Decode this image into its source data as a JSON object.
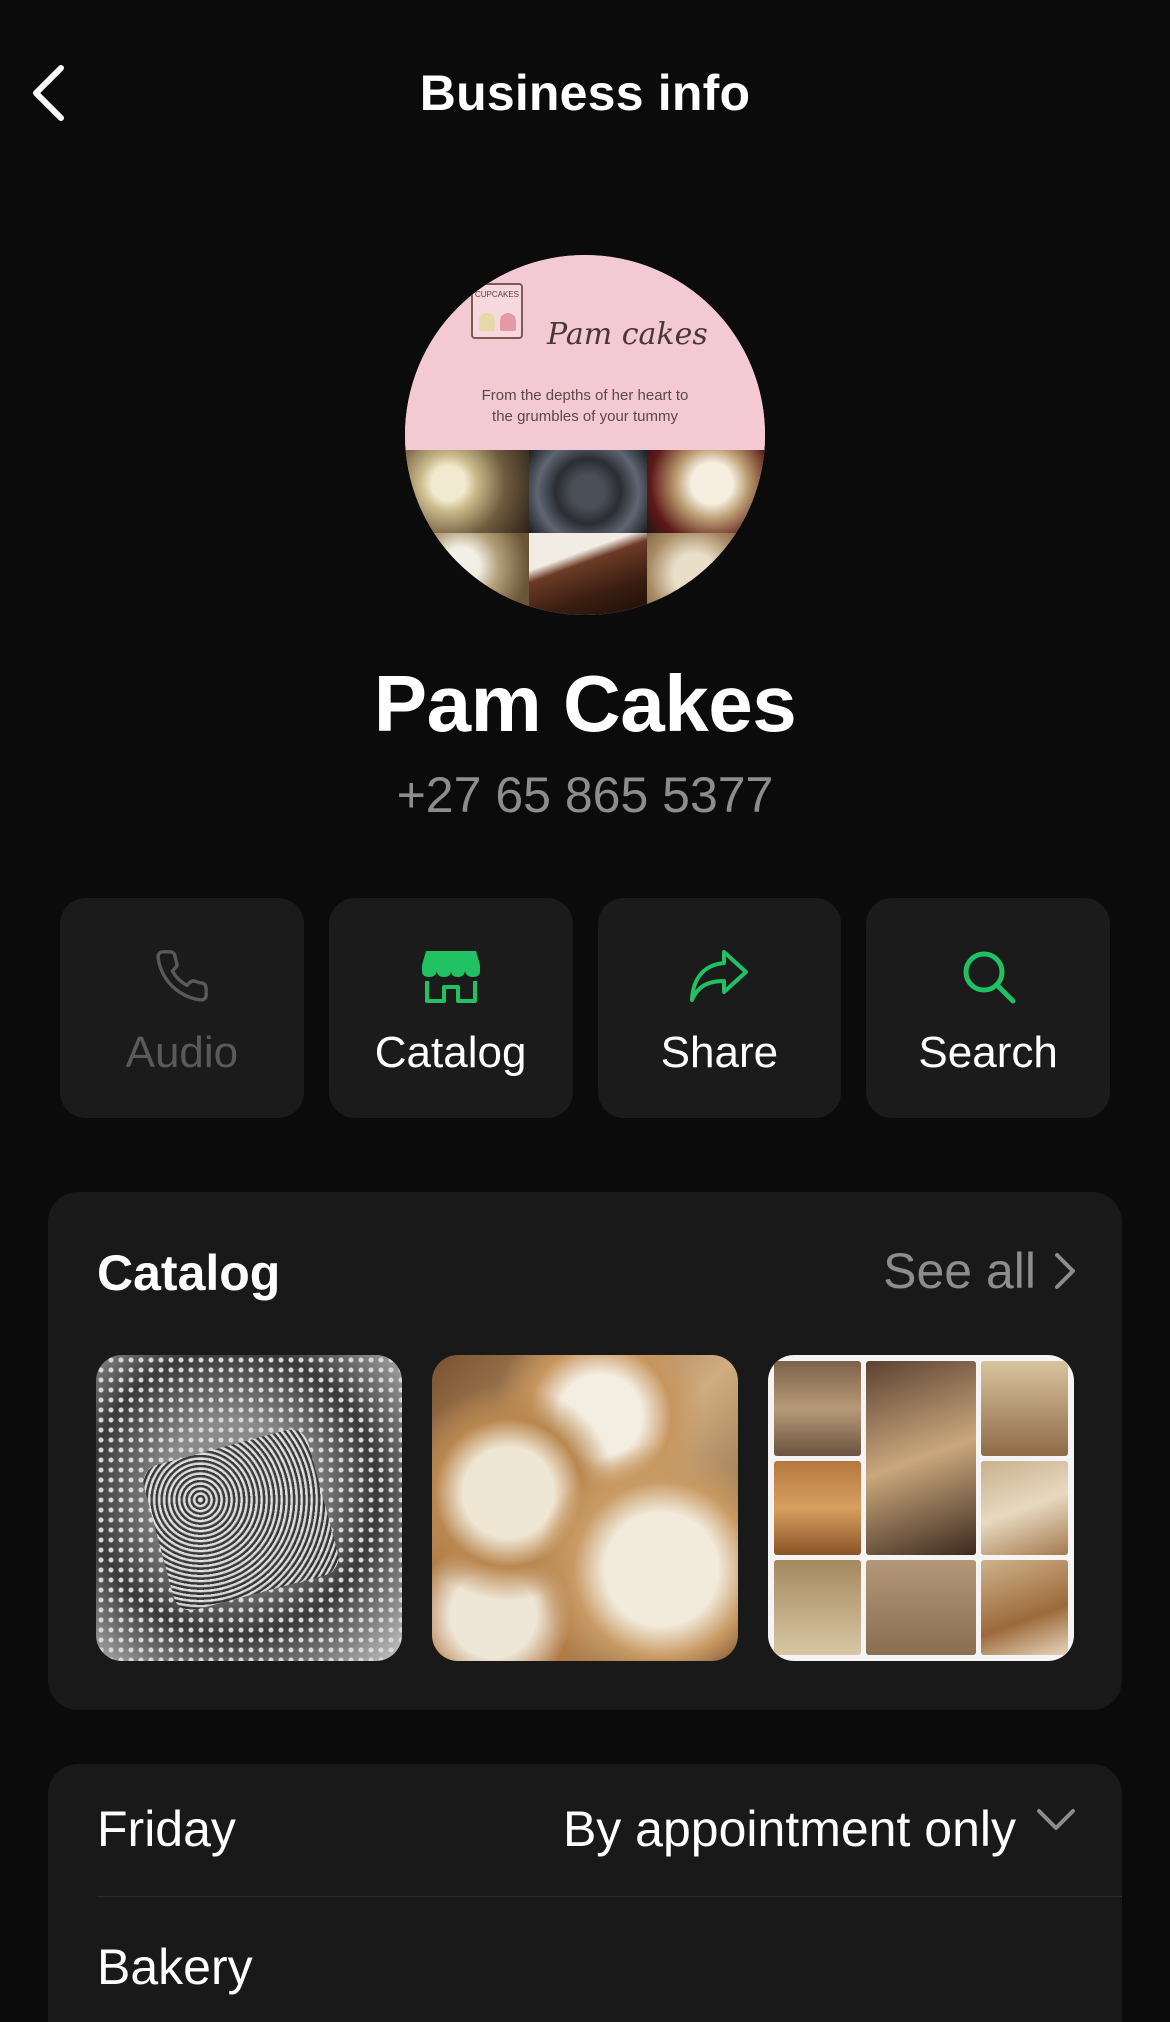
{
  "header": {
    "title": "Business info",
    "back_icon": "chevron-left-icon"
  },
  "avatar": {
    "brand": "Pam cakes",
    "box_label": "CUPCAKES",
    "tagline_line1": "From the depths of her heart to",
    "tagline_line2": "the grumbles of your tummy"
  },
  "business": {
    "name": "Pam Cakes",
    "phone": "+27 65 865 5377"
  },
  "actions": [
    {
      "label": "Audio",
      "icon": "phone-icon",
      "enabled": false
    },
    {
      "label": "Catalog",
      "icon": "storefront-icon",
      "enabled": true
    },
    {
      "label": "Share",
      "icon": "share-arrow-icon",
      "enabled": true
    },
    {
      "label": "Search",
      "icon": "search-icon",
      "enabled": true
    }
  ],
  "catalog": {
    "title": "Catalog",
    "see_all": "See all",
    "items": [
      {
        "image": "lamingtons"
      },
      {
        "image": "cinnamon-buns"
      },
      {
        "image": "cookie-boxes"
      }
    ]
  },
  "info": {
    "hours_day": "Friday",
    "hours_status": "By appointment only",
    "category": "Bakery"
  },
  "colors": {
    "background": "#0b0b0b",
    "card": "#191919",
    "accent_green": "#21c063",
    "muted_text": "#8d8d8d"
  }
}
